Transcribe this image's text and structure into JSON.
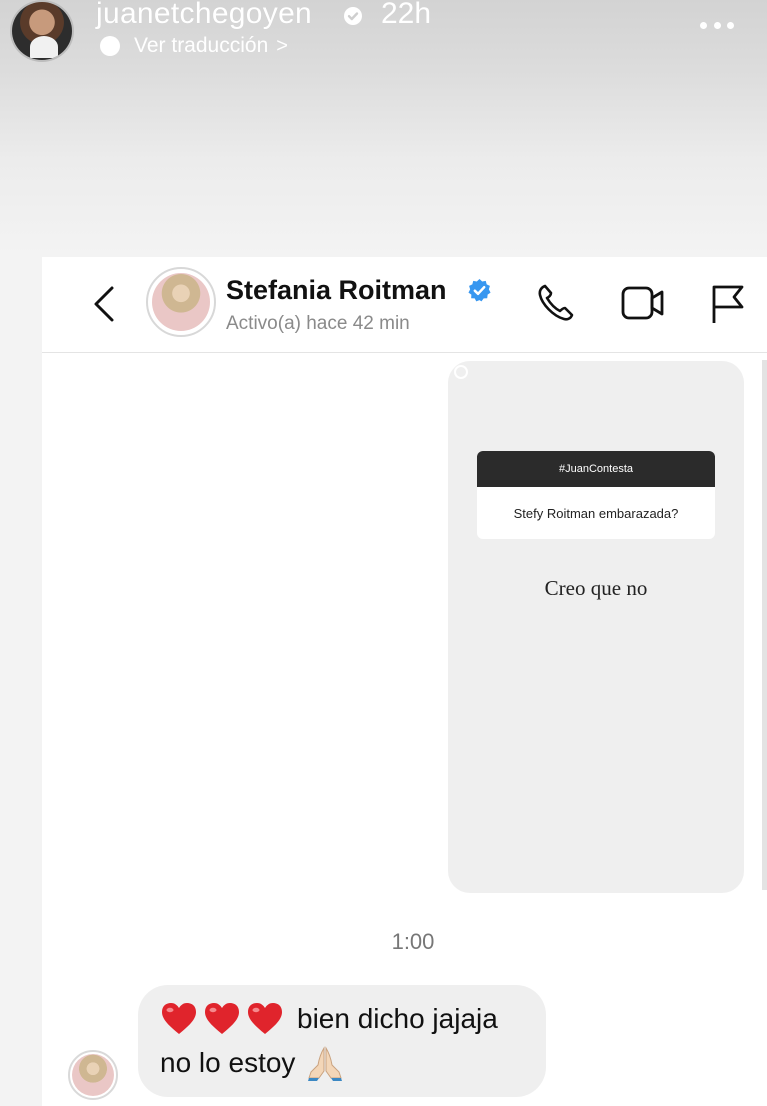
{
  "story": {
    "username": "juanetchegoyen",
    "time": "22h",
    "translate_label": "Ver traducción",
    "translate_chevron": ">"
  },
  "dm": {
    "contact_name": "Stefania Roitman",
    "status": "Activo(a) hace 42 min",
    "story_reply": {
      "hashtag": "#JuanContesta",
      "question": "Stefy Roitman embarazada?",
      "answer": "Creo que no"
    },
    "timestamp": "1:00",
    "message": {
      "line1": "bien dicho jajaja",
      "line2": "no lo estoy",
      "emoji_hearts": "❤️❤️❤️",
      "emoji_pray": "🙏🏻"
    }
  },
  "colors": {
    "verified_blue": "#3897f0",
    "heart_red": "#e0242c",
    "bubble_gray": "#efefef",
    "question_header": "#2b2b2b"
  },
  "icons": [
    "translate-icon",
    "more-icon",
    "verified-icon",
    "back-icon",
    "phone-icon",
    "video-icon",
    "flag-icon",
    "heart-icon",
    "pray-icon"
  ]
}
